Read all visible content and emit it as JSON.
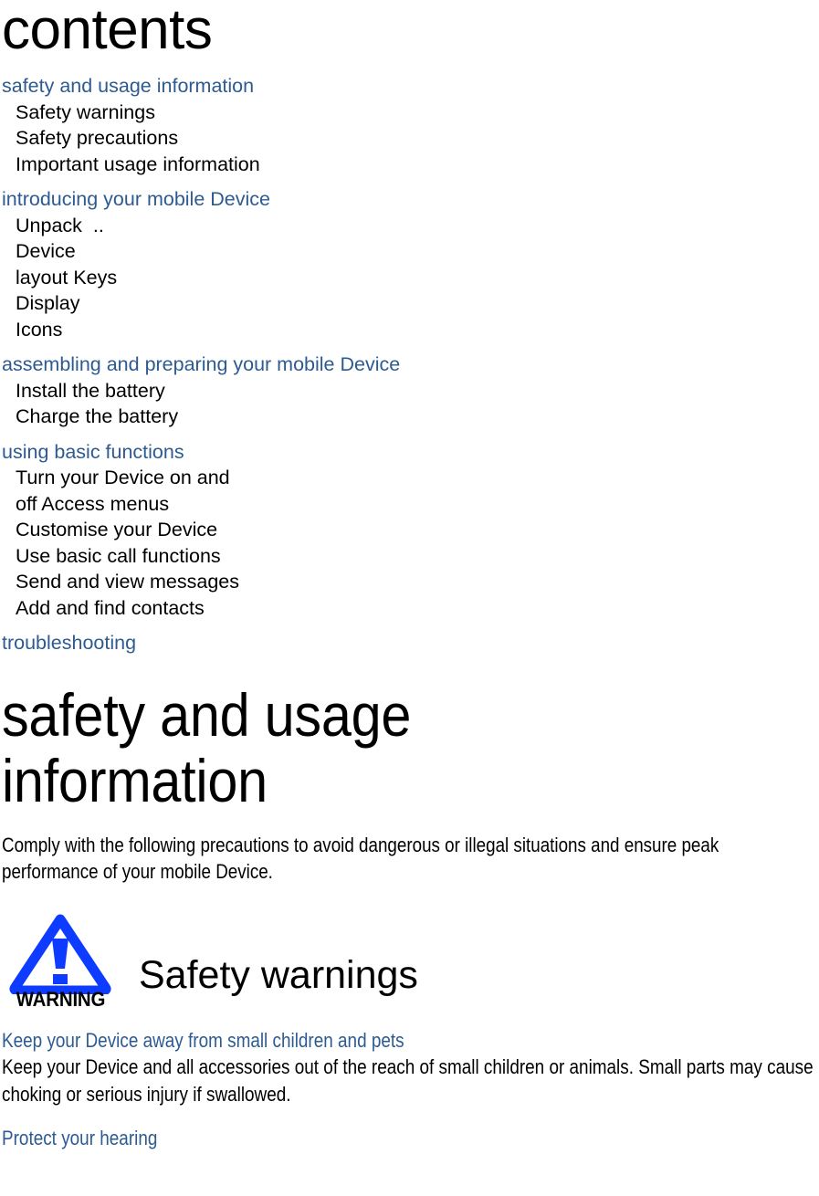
{
  "document": {
    "contents_title": "contents"
  },
  "toc": {
    "groups": [
      {
        "section": "safety and usage information",
        "entries": [
          "Safety warnings",
          "Safety precautions",
          "Important usage information"
        ]
      },
      {
        "section": "introducing your mobile Device",
        "entries": [
          "Unpack  ..",
          "Device",
          "layout Keys",
          "Display",
          "Icons"
        ]
      },
      {
        "section": "assembling and preparing your mobile Device",
        "entries": [
          "Install the battery",
          "Charge the battery"
        ]
      },
      {
        "section": "using basic functions",
        "entries": [
          "Turn your Device on and",
          "off Access menus",
          "Customise your Device",
          "Use basic call functions",
          "Send and view messages",
          "Add and find contacts"
        ]
      },
      {
        "section": "troubleshooting",
        "entries": []
      }
    ]
  },
  "chapter": {
    "heading_line1": "safety and usage",
    "heading_line2": "information",
    "intro": "Comply with the following precautions to avoid dangerous or illegal situations and ensure peak performance of your mobile Device."
  },
  "warning": {
    "icon_label": "WARNING",
    "icon_name": "warning-triangle-icon",
    "section_heading": "Safety warnings",
    "triangle_color": "#0D3BFF"
  },
  "safety_items": [
    {
      "title": "Keep your Device away from small children and pets",
      "body": "Keep your Device and all accessories out of the reach of small children or animals. Small parts may cause choking or serious injury if swallowed."
    },
    {
      "title": "Protect your hearing",
      "body": ""
    }
  ],
  "colors": {
    "heading_blue": "#2D5B91",
    "warning_blue": "#0D3BFF",
    "text_black": "#000000",
    "page_background": "#FFFFFF"
  }
}
